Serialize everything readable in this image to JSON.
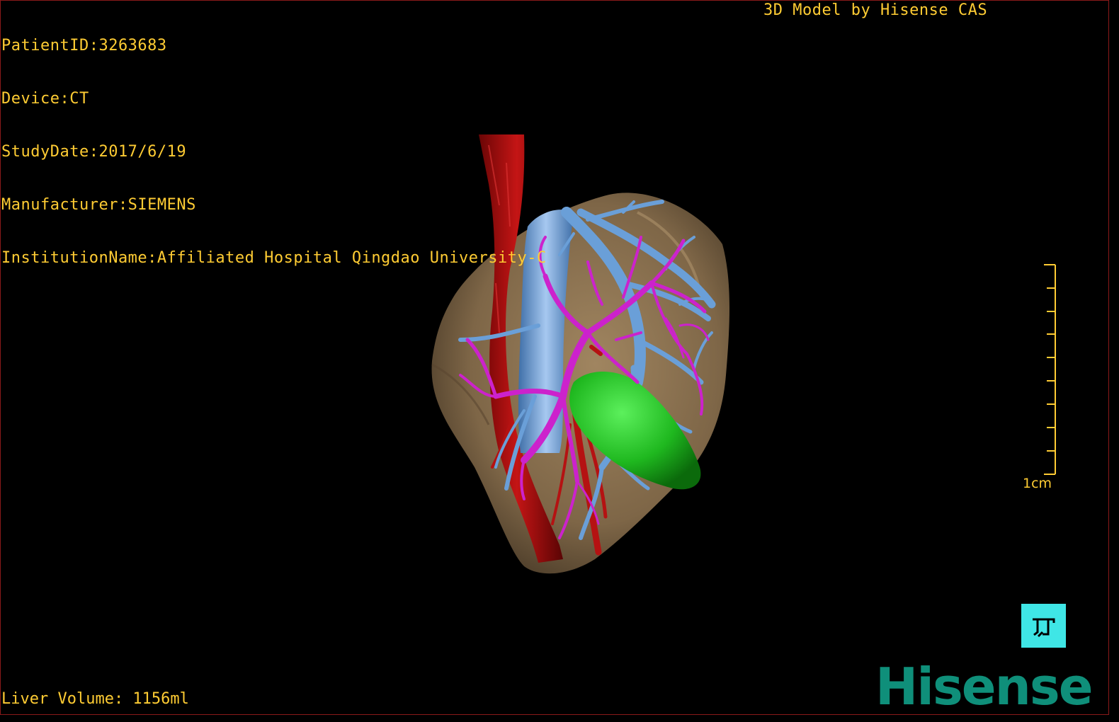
{
  "study_info": {
    "patient_id": "PatientID:3263683",
    "device": "Device:CT",
    "study_date": "StudyDate:2017/6/19",
    "manufacturer": "Manufacturer:SIEMENS",
    "institution": "InstitutionName:Affiliated Hospital Qingdao University-C"
  },
  "header": {
    "model_credit": "3D Model by Hisense CAS"
  },
  "footer": {
    "liver_volume": "Liver Volume: 1156ml"
  },
  "scale": {
    "label": "1cm"
  },
  "orientation_button": {
    "icon": "orientation-cube-icon"
  },
  "brand": {
    "logo_text": "Hisense"
  },
  "colors": {
    "overlay_text": "#ffcc33",
    "liver": "#8c7352",
    "aorta": "#b01010",
    "portal_vein": "#6a9fd8",
    "hepatic_vein": "#cc22cc",
    "gallbladder": "#1fb81f",
    "brand": "#0f8f7a"
  }
}
